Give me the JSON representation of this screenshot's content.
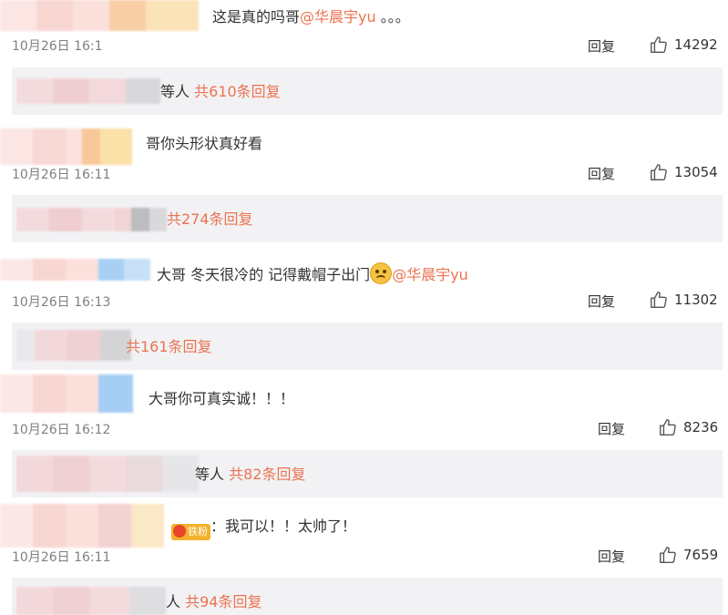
{
  "colors": {
    "accent": "#eb7350",
    "bar_bg": "#f2f2f5",
    "text": "#333333",
    "muted": "#808080"
  },
  "reply_label": "回复",
  "comments": [
    {
      "text": "这是真的吗哥",
      "mention": "@华晨宇yu",
      "suffix": " 。。。",
      "time": "10月26日 16:1",
      "likes": "14292"
    },
    {
      "text": "哥你头形状真好看",
      "time": "10月26日 16:11",
      "likes": "13054"
    },
    {
      "text": "大哥 冬天很冷的 记得戴帽子出门",
      "mention": "@华晨宇yu",
      "time": "10月26日 16:13",
      "likes": "11302"
    },
    {
      "text": "大哥你可真实诚！！！",
      "time": "10月26日 16:12",
      "likes": "8236"
    },
    {
      "badge": "铁粉",
      "text": "：我可以！！太帅了！",
      "time": "10月26日 16:11",
      "likes": "7659"
    }
  ],
  "reply_bars": [
    {
      "prefix": "等人",
      "count": "共610条回复"
    },
    {
      "prefix": "",
      "count": "共274条回复"
    },
    {
      "prefix": "",
      "count": "共161条回复"
    },
    {
      "prefix": "等人",
      "count": "共82条回复"
    },
    {
      "prefix": "人",
      "count": "共94条回复"
    }
  ],
  "icons": {
    "like": "thumbs-up-icon",
    "emoji": "crying-laughing-emoji-icon",
    "badge": "fan-badge-icon"
  }
}
